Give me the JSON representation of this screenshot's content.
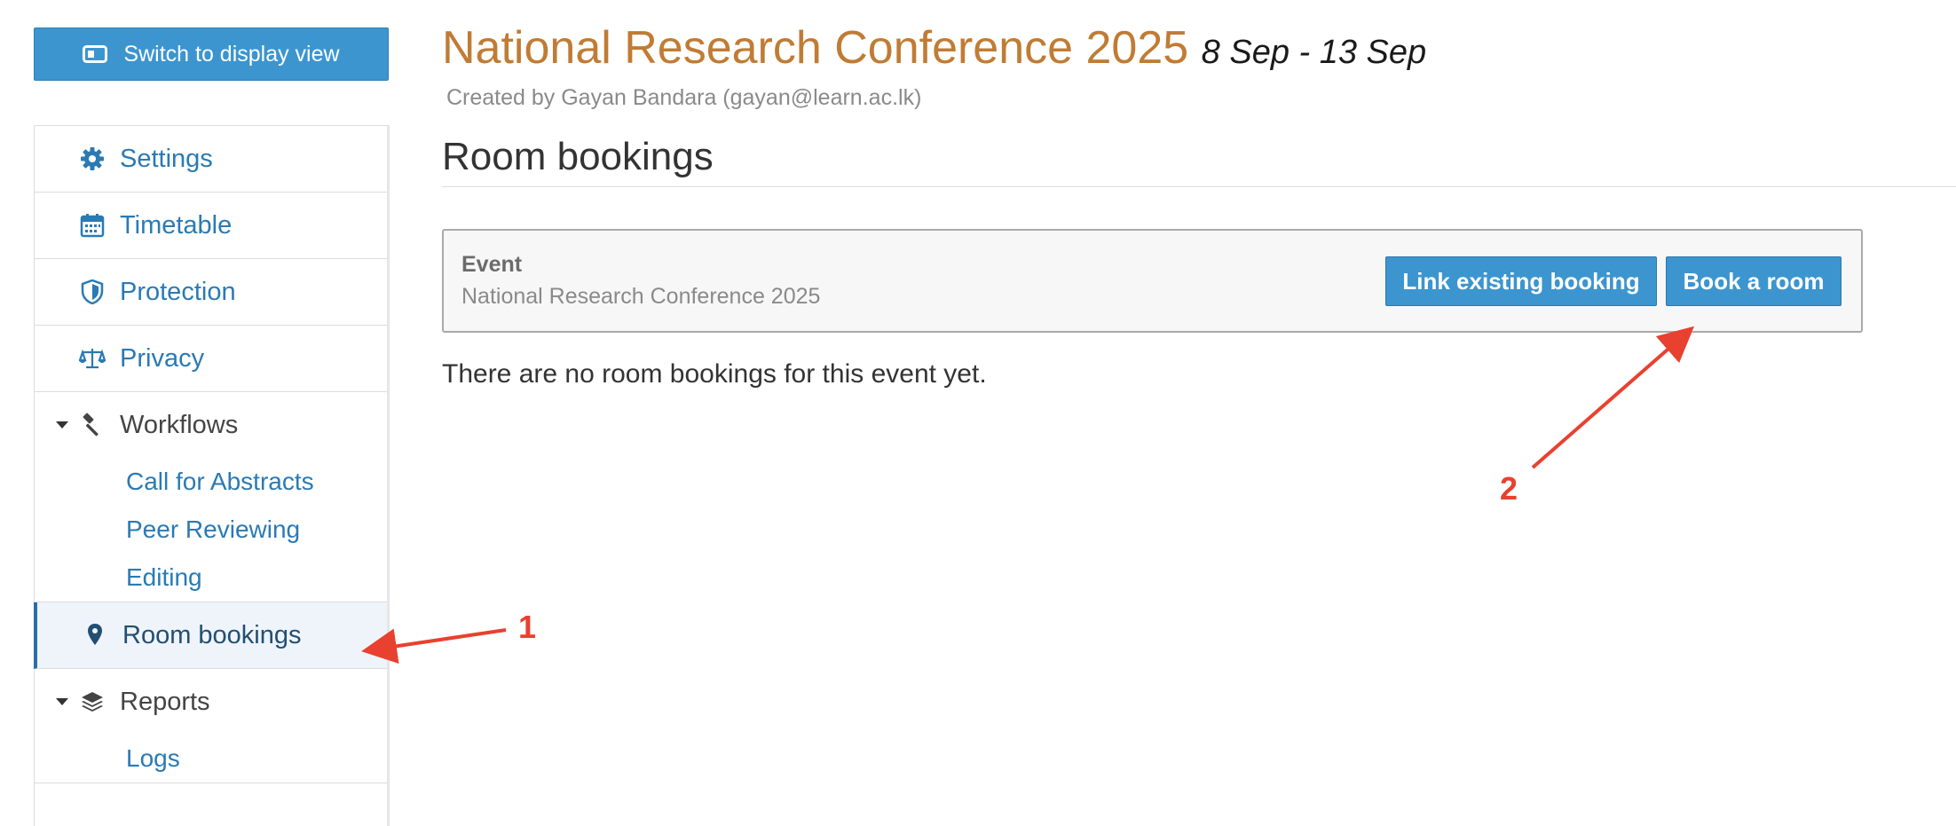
{
  "switch_button": {
    "label": "Switch to display view",
    "icon": "display-view-icon"
  },
  "sidebar": {
    "items": [
      {
        "label": "Settings",
        "icon": "gear-icon"
      },
      {
        "label": "Timetable",
        "icon": "calendar-icon"
      },
      {
        "label": "Protection",
        "icon": "shield-icon"
      },
      {
        "label": "Privacy",
        "icon": "scales-icon"
      }
    ],
    "workflows": {
      "label": "Workflows",
      "icon": "gavel-icon",
      "children": [
        "Call for Abstracts",
        "Peer Reviewing",
        "Editing"
      ]
    },
    "active_item": {
      "label": "Room bookings",
      "icon": "map-pin-icon"
    },
    "reports": {
      "label": "Reports",
      "icon": "layers-icon",
      "children": [
        "Logs"
      ]
    }
  },
  "header": {
    "title": "National Research Conference 2025",
    "dates": "8 Sep - 13 Sep",
    "created_by": "Created by Gayan Bandara (gayan@learn.ac.lk)"
  },
  "main": {
    "page_title": "Room bookings",
    "event_box": {
      "label": "Event",
      "event_name": "National Research Conference 2025",
      "link_button": "Link existing booking",
      "book_button": "Book a room"
    },
    "empty_message": "There are no room bookings for this event yet."
  },
  "annotations": {
    "marker_1": "1",
    "marker_2": "2",
    "color": "#e8412f"
  },
  "colors": {
    "accent": "#3c95cf",
    "title": "#c07c34",
    "link": "#2a7ab3"
  }
}
